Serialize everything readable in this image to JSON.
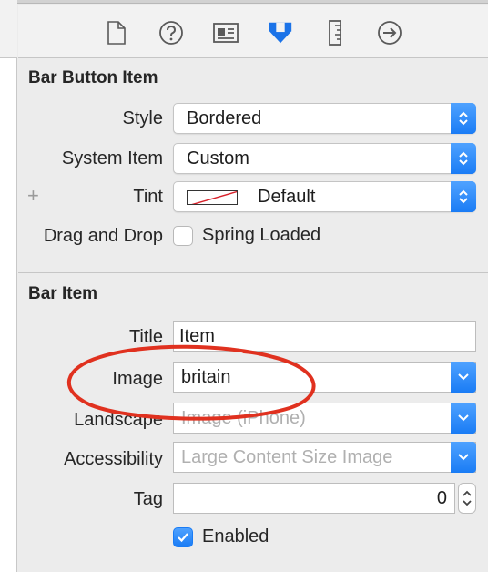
{
  "toolbar": {
    "icons": [
      "file-inspector-icon",
      "quick-help-icon",
      "identity-inspector-icon",
      "attributes-inspector-icon",
      "size-inspector-icon",
      "connections-inspector-icon"
    ]
  },
  "bar_button_item": {
    "title": "Bar Button Item",
    "style_label": "Style",
    "style_value": "Bordered",
    "system_item_label": "System Item",
    "system_item_value": "Custom",
    "tint_label": "Tint",
    "tint_value": "Default",
    "drag_drop_label": "Drag and Drop",
    "spring_loaded_label": "Spring Loaded"
  },
  "bar_item": {
    "title": "Bar Item",
    "title_label": "Title",
    "title_value": "Item",
    "image_label": "Image",
    "image_value": "britain",
    "landscape_label": "Landscape",
    "landscape_placeholder": "Image (iPhone)",
    "accessibility_label": "Accessibility",
    "accessibility_placeholder": "Large Content Size Image",
    "tag_label": "Tag",
    "tag_value": "0",
    "enabled_label": "Enabled"
  },
  "colors": {
    "accent": "#1a7cf5",
    "annotation": "#e0311f",
    "selected_icon": "#1b73e8"
  }
}
